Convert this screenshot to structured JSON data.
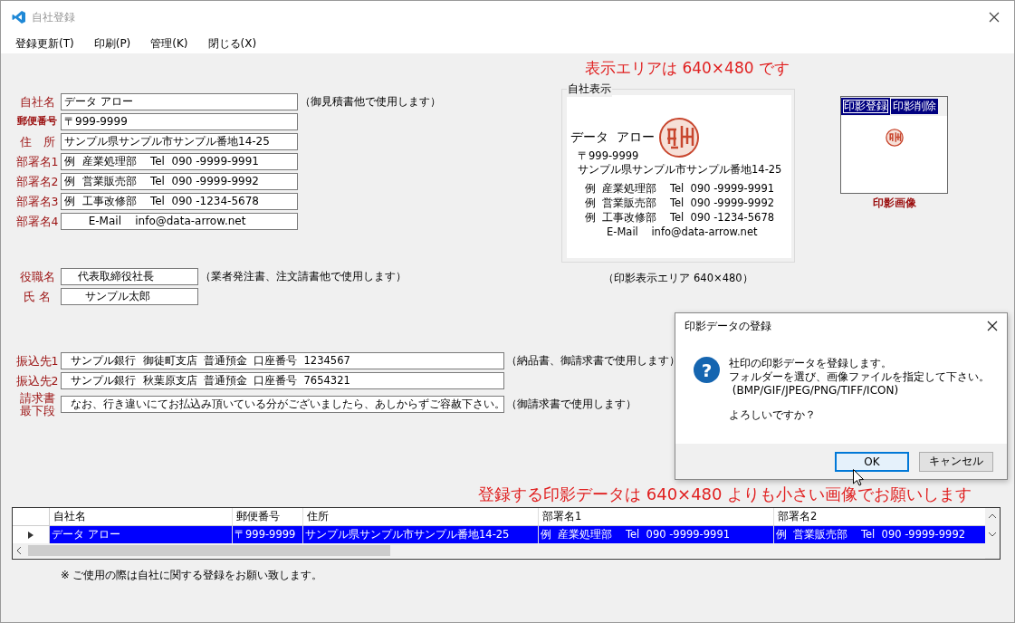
{
  "window": {
    "title": "自社登録"
  },
  "menu": [
    {
      "label": "登録更新(T)"
    },
    {
      "label": "印刷(P)"
    },
    {
      "label": "管理(K)"
    },
    {
      "label": "閉じる(X)"
    }
  ],
  "form": {
    "sections": [
      [
        {
          "label": "自社名",
          "value": "データ アロー",
          "note": "（御見積書他で使用します）"
        },
        {
          "label": "郵便番号",
          "value": "〒999-9999"
        },
        {
          "label": "住　所",
          "value": "サンプル県サンプル市サンプル番地14-25"
        },
        {
          "label": "部署名1",
          "value": "例  産業処理部    Tel  090 -9999-9991"
        },
        {
          "label": "部署名2",
          "value": "例  営業販売部    Tel  090 -9999-9992"
        },
        {
          "label": "部署名3",
          "value": "例  工事改修部    Tel  090 -1234-5678"
        },
        {
          "label": "部署名4",
          "value": "       E-Mail    info@data-arrow.net"
        }
      ],
      [
        {
          "label": "役職名",
          "value": "    代表取締役社長",
          "note": "（業者発注書、注文請書他で使用します）"
        },
        {
          "label": "氏  名",
          "value": "      サンプル太郎"
        }
      ],
      [
        {
          "label": "振込先1",
          "value": "  サンプル銀行  御徒町支店  普通預金  口座番号  1234567",
          "note": "（納品書、御請求書で使用します）"
        },
        {
          "label": "振込先2",
          "value": "  サンプル銀行  秋葉原支店  普通預金  口座番号  7654321"
        },
        {
          "label": "請求書最下段",
          "value": "  なお、行き違いにてお払込み頂いている分がございましたら、あしからずご容赦下さい。",
          "note": "（御請求書で使用します）"
        }
      ]
    ]
  },
  "annotations": [
    {
      "text": "表示エリアは 640×480 です"
    },
    {
      "text": "登録する印影データは 640×480 よりも小さい画像でお願いします"
    }
  ],
  "preview": {
    "title": "自社表示",
    "company": "データ  アロー",
    "postal": "〒999-9999",
    "address": "サンプル県サンプル市サンプル番地14-25",
    "departments": [
      "例  産業処理部    Tel  090 -9999-9991",
      "例  営業販売部    Tel  090 -9999-9992",
      "例  工事改修部    Tel  090 -1234-5678"
    ],
    "email": "E-Mail    info@data-arrow.net",
    "caption": "（印影表示エリア 640×480）"
  },
  "stamp_panel": {
    "buttons": [
      {
        "label": "印影登録",
        "selected": true
      },
      {
        "label": "印影削除",
        "selected": false
      }
    ],
    "caption": "印影画像"
  },
  "dialog": {
    "title": "印影データの登録",
    "icon": "?",
    "lines": [
      "社印の印影データを登録します。",
      "フォルダーを選び、画像ファイルを指定して下さい。",
      " (BMP/GIF/JPEG/PNG/TIFF/ICON)"
    ],
    "question": "よろしいですか？",
    "buttons": [
      {
        "label": "OK",
        "selected": true
      },
      {
        "label": "キャンセル",
        "selected": false
      }
    ]
  },
  "table": {
    "columns": [
      "自社名",
      "郵便番号",
      "住所",
      "部署名1",
      "部署名2"
    ],
    "rows": [
      {
        "selected": true,
        "cells": [
          "データ アロー",
          "〒999-9999",
          "サンプル県サンプル市サンプル番地14-25",
          "例  産業処理部    Tel  090 -9999-9991",
          "例  営業販売部    Tel  090 -9999-9992"
        ]
      }
    ]
  },
  "footnote": "※ ご使用の際は自社に関する登録をお願い致します。"
}
